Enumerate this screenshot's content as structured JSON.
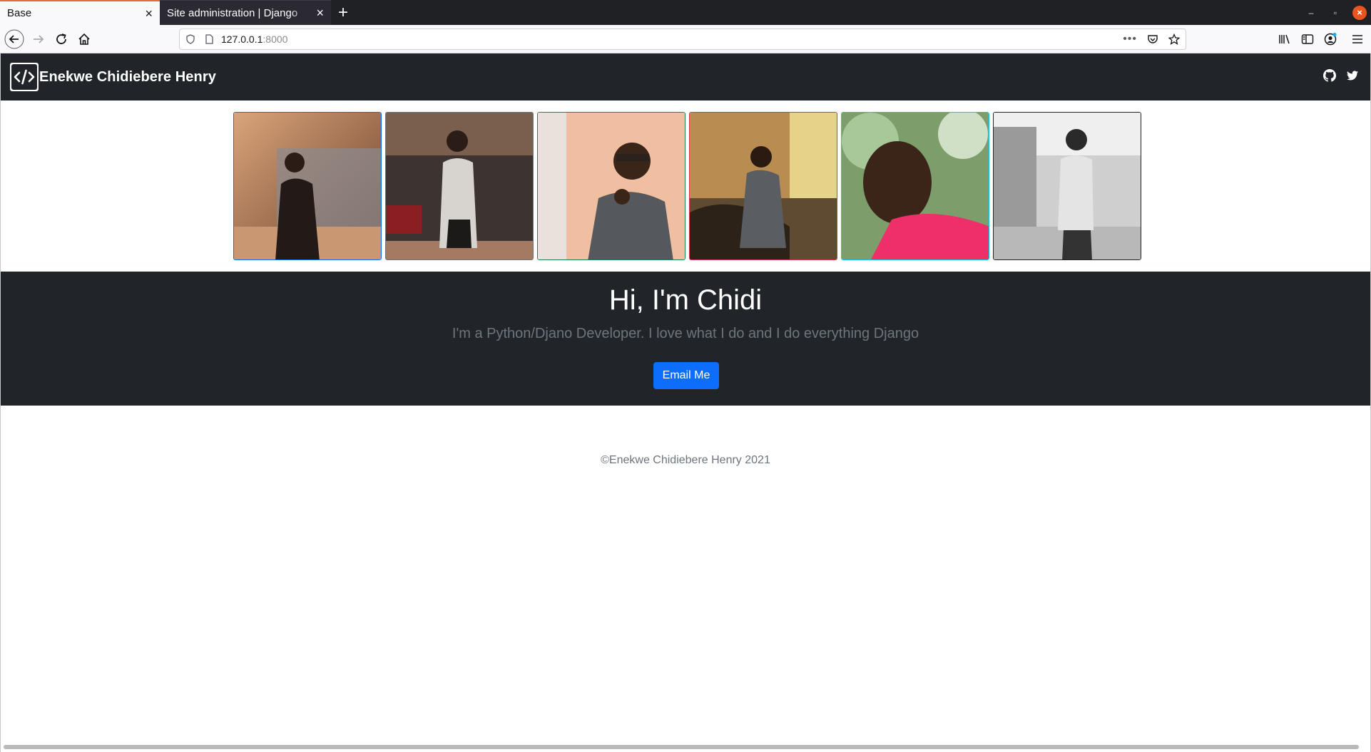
{
  "browser": {
    "tabs": [
      {
        "label": "Base",
        "active": true
      },
      {
        "label": "Site administration | Django",
        "active": false
      }
    ],
    "url_host": "127.0.0.1",
    "url_port": ":8000"
  },
  "site": {
    "brand": "Enekwe Chidiebere Henry",
    "social": [
      "github-icon",
      "twitter-icon"
    ]
  },
  "gallery": {
    "photos": [
      {
        "border": "#0d6efd"
      },
      {
        "border": "#6c757d"
      },
      {
        "border": "#198754"
      },
      {
        "border": "#dc3545"
      },
      {
        "border": "#0dcaf0"
      },
      {
        "border": "#212529"
      }
    ]
  },
  "hero": {
    "title": "Hi, I'm Chidi",
    "lead": "I'm a Python/Djano Developer. I love what I do and I do everything Django",
    "button": "Email Me"
  },
  "footer": {
    "text": "©Enekwe Chidiebere Henry 2021"
  },
  "colors": {
    "dark": "#212529",
    "primary": "#0d6efd",
    "muted": "#6c757d"
  }
}
